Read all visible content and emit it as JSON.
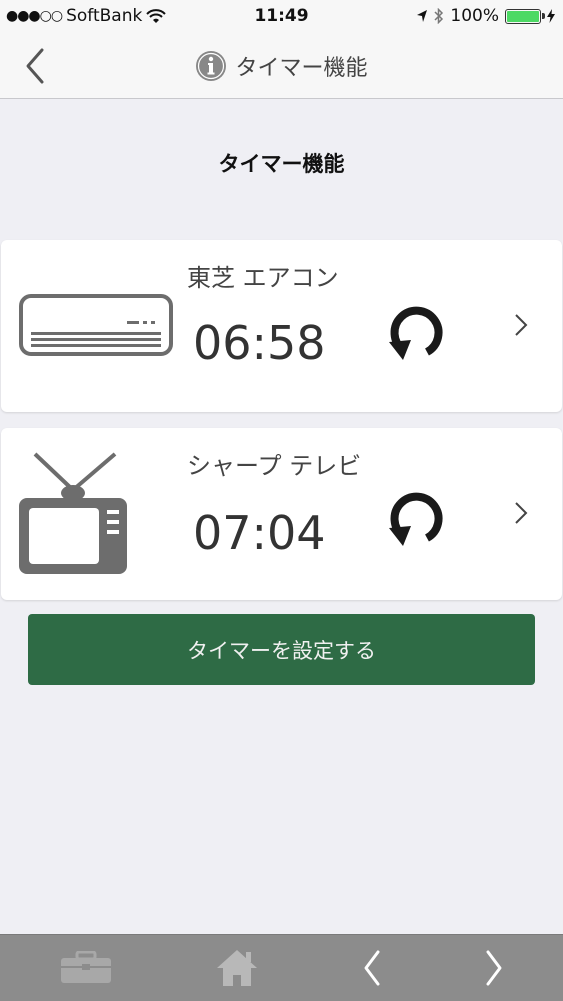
{
  "status_bar": {
    "carrier": "SoftBank",
    "time": "11:49",
    "battery_percent": "100%"
  },
  "nav": {
    "title": "タイマー機能",
    "icons": {
      "back": "chevron-left-icon",
      "info": "info-icon"
    }
  },
  "section": {
    "title": "タイマー機能"
  },
  "timers": [
    {
      "device": "東芝 エアコン",
      "time": "06:58",
      "icon": "air-conditioner-icon"
    },
    {
      "device": "シャープ テレビ",
      "time": "07:04",
      "icon": "television-icon"
    }
  ],
  "button": {
    "label": "タイマーを設定する",
    "color": "#2e6b45"
  },
  "bottom_bar": {
    "items": [
      "toolbox-icon",
      "home-icon",
      "chevron-left-icon",
      "chevron-right-icon"
    ]
  },
  "colors": {
    "accent_green": "#2e6b45",
    "battery": "#4cd964",
    "bottom_bar": "#8c8c8c"
  }
}
